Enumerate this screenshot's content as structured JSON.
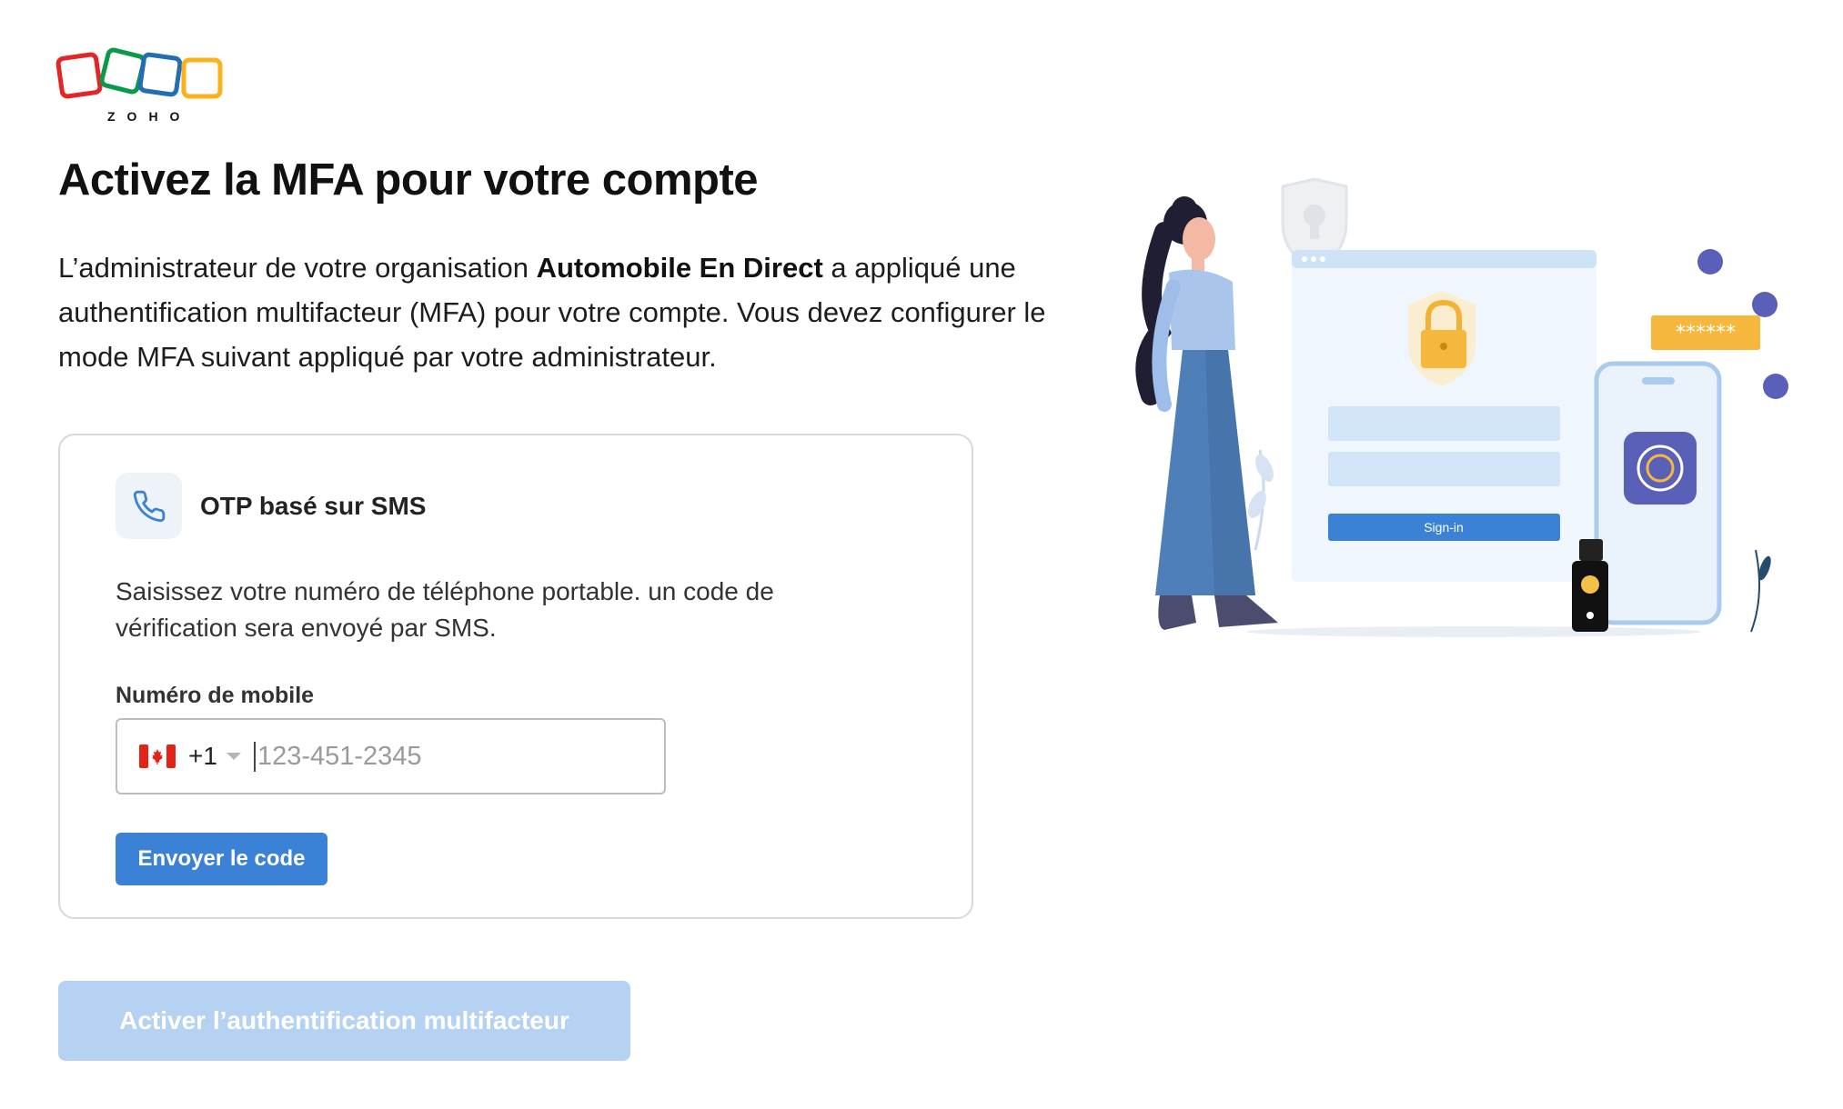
{
  "brand": {
    "logo_text": "ZOHO"
  },
  "page": {
    "title": "Activez la MFA pour votre compte",
    "description_before": "L’administrateur de votre organisation ",
    "organization_name": "Automobile En Direct",
    "description_after": " a appliqué une authentification multifacteur (MFA) pour votre compte. Vous devez configurer le mode MFA suivant appliqué par votre administrateur."
  },
  "mfa_card": {
    "icon": "phone-icon",
    "method_title": "OTP basé sur SMS",
    "instructions": "Saisissez votre numéro de téléphone portable. un code de vérification sera envoyé par SMS.",
    "field_label": "Numéro de mobile",
    "country_flag": "canada-flag-icon",
    "dial_code": "+1",
    "phone_value": "",
    "phone_placeholder": "123-451-2345",
    "send_button": "Envoyer le code"
  },
  "footer": {
    "enable_button": "Activer l’authentification multifacteur"
  },
  "illustration": {
    "signin_label": "Sign-in",
    "password_mask": "******"
  },
  "colors": {
    "primary": "#3b82d6",
    "primary_disabled": "#b6d2f3",
    "logo_red": "#e42527",
    "logo_green": "#089949",
    "logo_blue": "#226db4",
    "logo_yellow": "#f9b21d"
  }
}
